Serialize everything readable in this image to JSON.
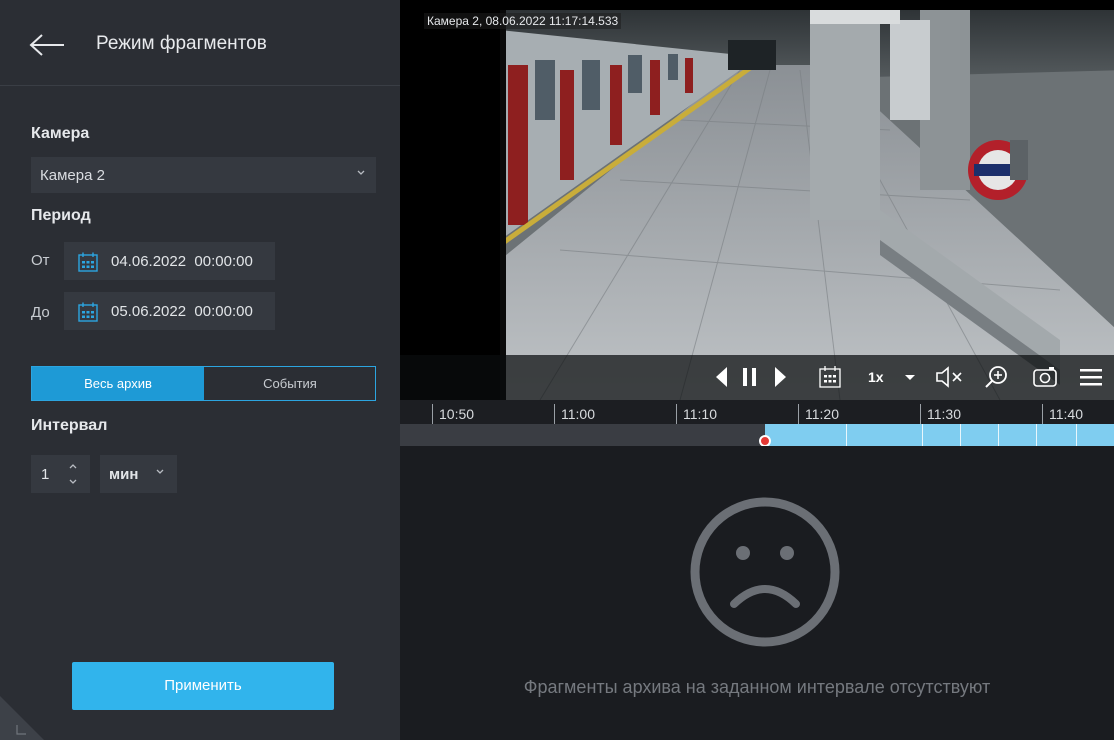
{
  "sidebar": {
    "title": "Режим фрагментов",
    "camera_label": "Камера",
    "camera_value": "Камера 2",
    "period_label": "Период",
    "from_label": "От",
    "from_value": "04.06.2022  00:00:00",
    "to_label": "До",
    "to_value": "05.06.2022  00:00:00",
    "mode_tabs": [
      {
        "label": "Весь архив",
        "active": true
      },
      {
        "label": "События",
        "active": false
      }
    ],
    "interval_label": "Интервал",
    "interval_value": "1",
    "interval_unit": "мин",
    "apply_label": "Применить"
  },
  "video": {
    "overlay_title": "Камера 2, 08.06.2022 11:17:14.533",
    "speed": "1x",
    "icons": [
      "step-back-icon",
      "pause-icon",
      "step-forward-icon",
      "calendar-icon",
      "chevron-down-icon",
      "mute-icon",
      "zoom-in-icon",
      "snapshot-icon",
      "menu-icon"
    ]
  },
  "timeline": {
    "ticks": [
      "10:50",
      "11:00",
      "11:10",
      "11:20",
      "11:30",
      "11:40"
    ]
  },
  "empty_state": {
    "icon": "sad-face-icon",
    "message": "Фрагменты архива на заданном интервале отсутствуют"
  },
  "colors": {
    "accent": "#1e9ad6",
    "apply_button": "#31b4ec",
    "timeline_fill": "#7fcdf0",
    "playhead": "#e53935",
    "sidebar_bg": "#2b2e34"
  }
}
